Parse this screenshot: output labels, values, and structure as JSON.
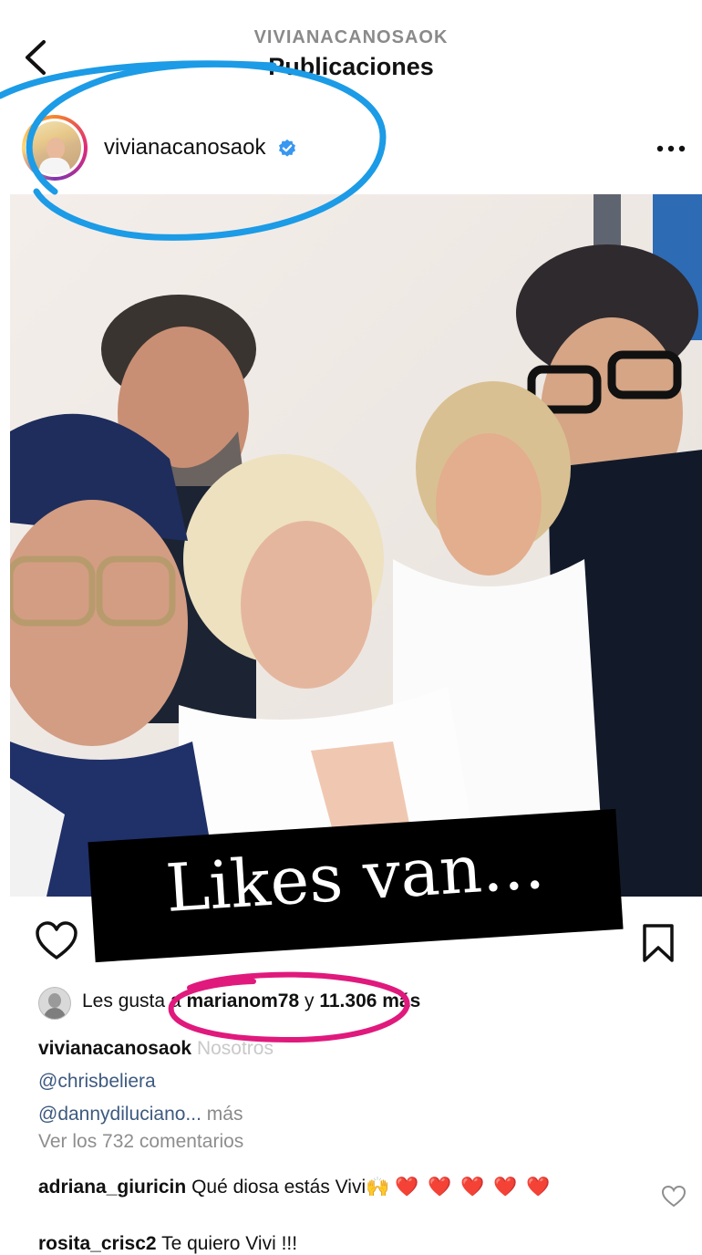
{
  "header": {
    "account": "VIVIANACANOSAOK",
    "title": "Publicaciones"
  },
  "post": {
    "username": "vivianacanosaok",
    "verified": true,
    "overlay_text": "Likes van...",
    "likes": {
      "prefix": "Les gusta a",
      "liker": "marianom78",
      "conjunction": "y",
      "count_text": "11.306 más"
    },
    "caption": {
      "username": "vivianacanosaok",
      "text": "Nosotros",
      "mentions": [
        "@chrisbeliera",
        "@dannydiluciano..."
      ],
      "more_label": "más"
    },
    "view_comments": "Ver los 732 comentarios",
    "comments": [
      {
        "username": "adriana_giuricin",
        "text": "Qué diosa estás Vivi🙌",
        "hearts": "❤️ ❤️ ❤️ ❤️ ❤️"
      },
      {
        "username": "rosita_crisc2",
        "text": "Te quiero Vivi !!!"
      }
    ]
  },
  "icons": {
    "back": "chevron-left-icon",
    "more": "more-dots-icon",
    "like": "heart-outline-icon",
    "save": "bookmark-icon",
    "verified": "verified-badge-icon"
  },
  "colors": {
    "annotation_blue": "#1c9be6",
    "annotation_pink": "#e0197d",
    "verified_blue": "#3897f0",
    "heart_red": "#e0202a"
  }
}
